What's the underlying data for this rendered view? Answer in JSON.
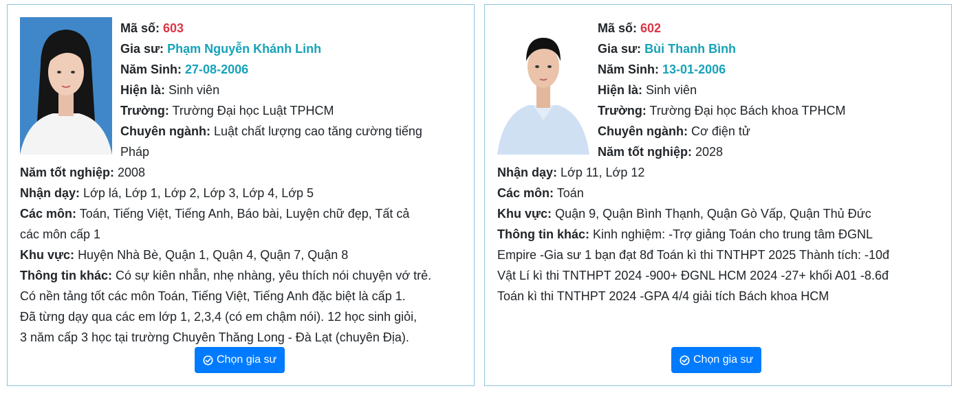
{
  "tutors": [
    {
      "code_label": "Mã số:",
      "code": "603",
      "name_label": "Gia sư:",
      "name": "Phạm Nguyễn Khánh Linh",
      "birth_label": "Năm Sinh:",
      "birth": "27-08-2006",
      "role_label": "Hiện là:",
      "role": "Sinh viên",
      "school_label": "Trường:",
      "school": "Trường Đại học Luật TPHCM",
      "major_label": "Chuyên ngành:",
      "major_part1": "Luật chất lượng cao tăng cường tiếng",
      "major_part2": "Pháp",
      "grad_label": "Năm tốt nghiệp:",
      "grad": "2008",
      "teach_label": "Nhận dạy:",
      "teach": "Lớp lá, Lớp 1, Lớp 2, Lớp 3, Lớp 4, Lớp 5",
      "subjects_label": "Các môn:",
      "subjects_part1": "Toán, Tiếng Việt, Tiếng Anh, Báo bài, Luyện chữ đẹp, Tất cả",
      "subjects_part2": "các môn cấp 1",
      "area_label": "Khu vực:",
      "area": "Huyện Nhà Bè, Quận 1, Quận 4, Quận 7, Quận 8",
      "other_label": "Thông tin khác:",
      "other_part1": "Có sự kiên nhẫn, nhẹ nhàng, yêu thích nói chuyện vớ trẻ.",
      "other_part2": "Có nền tảng tốt các môn Toán, Tiếng Việt, Tiếng Anh đặc biệt là cấp 1.",
      "other_part3": "Đã từng dạy qua các em lớp 1, 2,3,4 (có em chậm nói). 12 học sinh giỏi,",
      "other_part4": "3 năm cấp 3 học tại trường Chuyên Thăng Long - Đà Lạt (chuyên Địa).",
      "button_label": "Chọn gia sư"
    },
    {
      "code_label": "Mã số:",
      "code": "602",
      "name_label": "Gia sư:",
      "name": "Bùi Thanh Bình",
      "birth_label": "Năm Sinh:",
      "birth": "13-01-2006",
      "role_label": "Hiện là:",
      "role": "Sinh viên",
      "school_label": "Trường:",
      "school": "Trường Đại học Bách khoa TPHCM",
      "major_label": "Chuyên ngành:",
      "major": "Cơ điện tử",
      "grad_label": "Năm tốt nghiệp:",
      "grad": "2028",
      "teach_label": "Nhận dạy:",
      "teach": "Lớp 11, Lớp 12",
      "subjects_label": "Các môn:",
      "subjects": "Toán",
      "area_label": "Khu vực:",
      "area": "Quận 9, Quận Bình Thạnh, Quận Gò Vấp, Quận Thủ Đức",
      "other_label": "Thông tin khác:",
      "other_part1": "Kinh nghiệm: -Trợ giảng Toán cho trung tâm ĐGNL",
      "other_part2": "Empire -Gia sư 1 bạn đạt 8đ Toán kì thi TNTHPT 2025 Thành tích: -10đ",
      "other_part3": "Vật Lí kì thi TNTHPT 2024 -900+ ĐGNL HCM 2024 -27+ khối A01 -8.6đ",
      "other_part4": "Toán kì thi TNTHPT 2024 -GPA 4/4 giải tích Bách khoa HCM",
      "button_label": "Chọn gia sư"
    }
  ],
  "colors": {
    "code": "#dc3545",
    "highlight": "#17a2b8",
    "button": "#007bff",
    "card_border": "#8cc3dc"
  },
  "icons": {
    "button": "check-circle-icon"
  }
}
